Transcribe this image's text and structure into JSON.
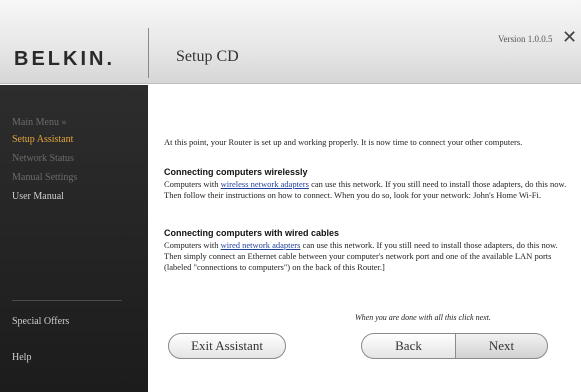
{
  "header": {
    "brand": "BELKIN.",
    "title": "Setup CD",
    "version": "Version 1.0.0.5",
    "close_glyph": "✕"
  },
  "sidebar": {
    "items": [
      {
        "label": "Main Menu  »",
        "state": "dim"
      },
      {
        "label": "Setup Assistant",
        "state": "active"
      },
      {
        "label": "Network Status",
        "state": "dim"
      },
      {
        "label": "Manual Settings",
        "state": "dim"
      },
      {
        "label": "User Manual",
        "state": "normal"
      }
    ],
    "bottom_items": [
      {
        "label": "Special Offers"
      },
      {
        "label": "Help"
      }
    ]
  },
  "main": {
    "intro": "At this point, your Router is set up and working properly. It is now time to connect your other computers.",
    "wireless": {
      "heading": "Connecting computers wirelessly",
      "text_before": "Computers with ",
      "link": "wireless network adapters",
      "text_after": " can use this network. If you still need to install those adapters, do this now. Then follow their instructions on how to connect. When you do so, look for your network: John's Home Wi-Fi."
    },
    "wired": {
      "heading": "Connecting computers with wired cables",
      "text_before": "Computers with ",
      "link": "wired network adapters",
      "text_after": " can use this network. If you still need to install those adapters, do this now. Then simply connect an Ethernet cable between your computer's network port and one of the available LAN ports (labeled \"connections to computers\") on the back of this Router.]"
    }
  },
  "footer": {
    "hint": "When you are done with all this click next.",
    "exit_label": "Exit Assistant",
    "back_label": "Back",
    "next_label": "Next"
  },
  "colors": {
    "sidebar_bg": "#222222",
    "active_nav": "#e3a33c",
    "link": "#1f3f9a"
  }
}
